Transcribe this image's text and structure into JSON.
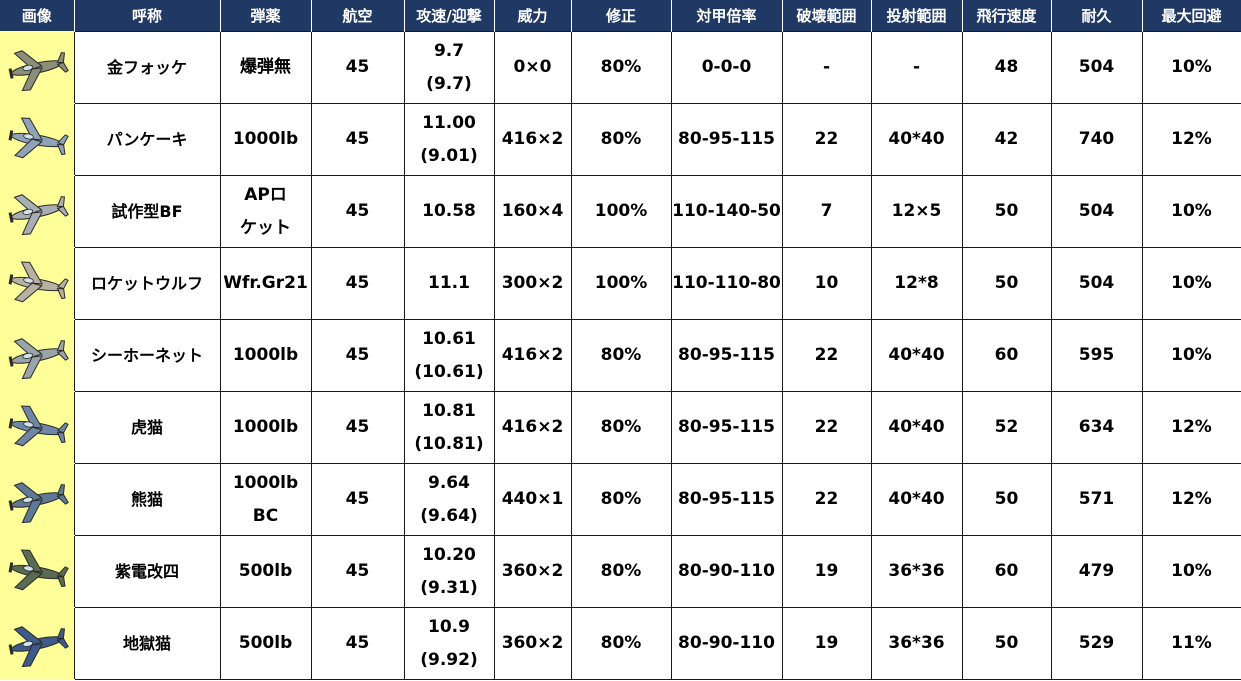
{
  "headers": [
    "画像",
    "呼称",
    "弾薬",
    "航空",
    "攻速/迎撃",
    "威力",
    "修正",
    "対甲倍率",
    "破壊範囲",
    "投射範囲",
    "飛行速度",
    "耐久",
    "最大回避"
  ],
  "rows": [
    {
      "icon": "fw190-plane-icon",
      "name": "金フォッケ",
      "ammo": [
        "爆弾無"
      ],
      "air": "45",
      "speed": [
        "9.7",
        "(9.7)"
      ],
      "power": "0×0",
      "correction": "80%",
      "armor": "0-0-0",
      "destroy_range": "-",
      "projection_range": "-",
      "flight_speed": "48",
      "durability": "504",
      "max_evasion": "10%"
    },
    {
      "icon": "pancake-plane-icon",
      "name": "パンケーキ",
      "ammo": [
        "1000lb"
      ],
      "air": "45",
      "speed": [
        "11.00",
        "(9.01)"
      ],
      "power": "416×2",
      "correction": "80%",
      "armor": "80-95-115",
      "destroy_range": "22",
      "projection_range": "40*40",
      "flight_speed": "42",
      "durability": "740",
      "max_evasion": "12%"
    },
    {
      "icon": "prototype-bf-plane-icon",
      "name": "試作型BF",
      "ammo": [
        "APロ",
        "ケット"
      ],
      "air": "45",
      "speed": [
        "10.58"
      ],
      "power": "160×4",
      "correction": "100%",
      "armor": "110-140-50",
      "destroy_range": "7",
      "projection_range": "12×5",
      "flight_speed": "50",
      "durability": "504",
      "max_evasion": "10%"
    },
    {
      "icon": "rocket-wolf-plane-icon",
      "name": "ロケットウルフ",
      "ammo": [
        "Wfr.Gr21"
      ],
      "air": "45",
      "speed": [
        "11.1"
      ],
      "power": "300×2",
      "correction": "100%",
      "armor": "110-110-80",
      "destroy_range": "10",
      "projection_range": "12*8",
      "flight_speed": "50",
      "durability": "504",
      "max_evasion": "10%"
    },
    {
      "icon": "sea-hornet-plane-icon",
      "name": "シーホーネット",
      "ammo": [
        "1000lb"
      ],
      "air": "45",
      "speed": [
        "10.61",
        "(10.61)"
      ],
      "power": "416×2",
      "correction": "80%",
      "armor": "80-95-115",
      "destroy_range": "22",
      "projection_range": "40*40",
      "flight_speed": "60",
      "durability": "595",
      "max_evasion": "10%"
    },
    {
      "icon": "tigercat-plane-icon",
      "name": "虎猫",
      "ammo": [
        "1000lb"
      ],
      "air": "45",
      "speed": [
        "10.81",
        "(10.81)"
      ],
      "power": "416×2",
      "correction": "80%",
      "armor": "80-95-115",
      "destroy_range": "22",
      "projection_range": "40*40",
      "flight_speed": "52",
      "durability": "634",
      "max_evasion": "12%"
    },
    {
      "icon": "bearcat-plane-icon",
      "name": "熊猫",
      "ammo": [
        "1000lb BC"
      ],
      "air": "45",
      "speed": [
        "9.64",
        "(9.64)"
      ],
      "power": "440×1",
      "correction": "80%",
      "armor": "80-95-115",
      "destroy_range": "22",
      "projection_range": "40*40",
      "flight_speed": "50",
      "durability": "571",
      "max_evasion": "12%"
    },
    {
      "icon": "shiden-kai-4-plane-icon",
      "name": "紫電改四",
      "ammo": [
        "500lb"
      ],
      "air": "45",
      "speed": [
        "10.20",
        "(9.31)"
      ],
      "power": "360×2",
      "correction": "80%",
      "armor": "80-90-110",
      "destroy_range": "19",
      "projection_range": "36*36",
      "flight_speed": "60",
      "durability": "479",
      "max_evasion": "10%"
    },
    {
      "icon": "hellcat-plane-icon",
      "name": "地獄猫",
      "ammo": [
        "500lb"
      ],
      "air": "45",
      "speed": [
        "10.9",
        "(9.92)"
      ],
      "power": "360×2",
      "correction": "80%",
      "armor": "80-90-110",
      "destroy_range": "19",
      "projection_range": "36*36",
      "flight_speed": "50",
      "durability": "529",
      "max_evasion": "11%"
    }
  ],
  "colors": {
    "header_bg": "#1f3864",
    "header_text": "#ffffff",
    "image_column_bg": "#ffff99",
    "plane_colors": [
      "#8a8f7a",
      "#8fa3b8",
      "#a9aeb3",
      "#b8b0a0",
      "#9aa3a8",
      "#6f86a4",
      "#5f7896",
      "#5a6b52",
      "#3d5a8a"
    ]
  }
}
